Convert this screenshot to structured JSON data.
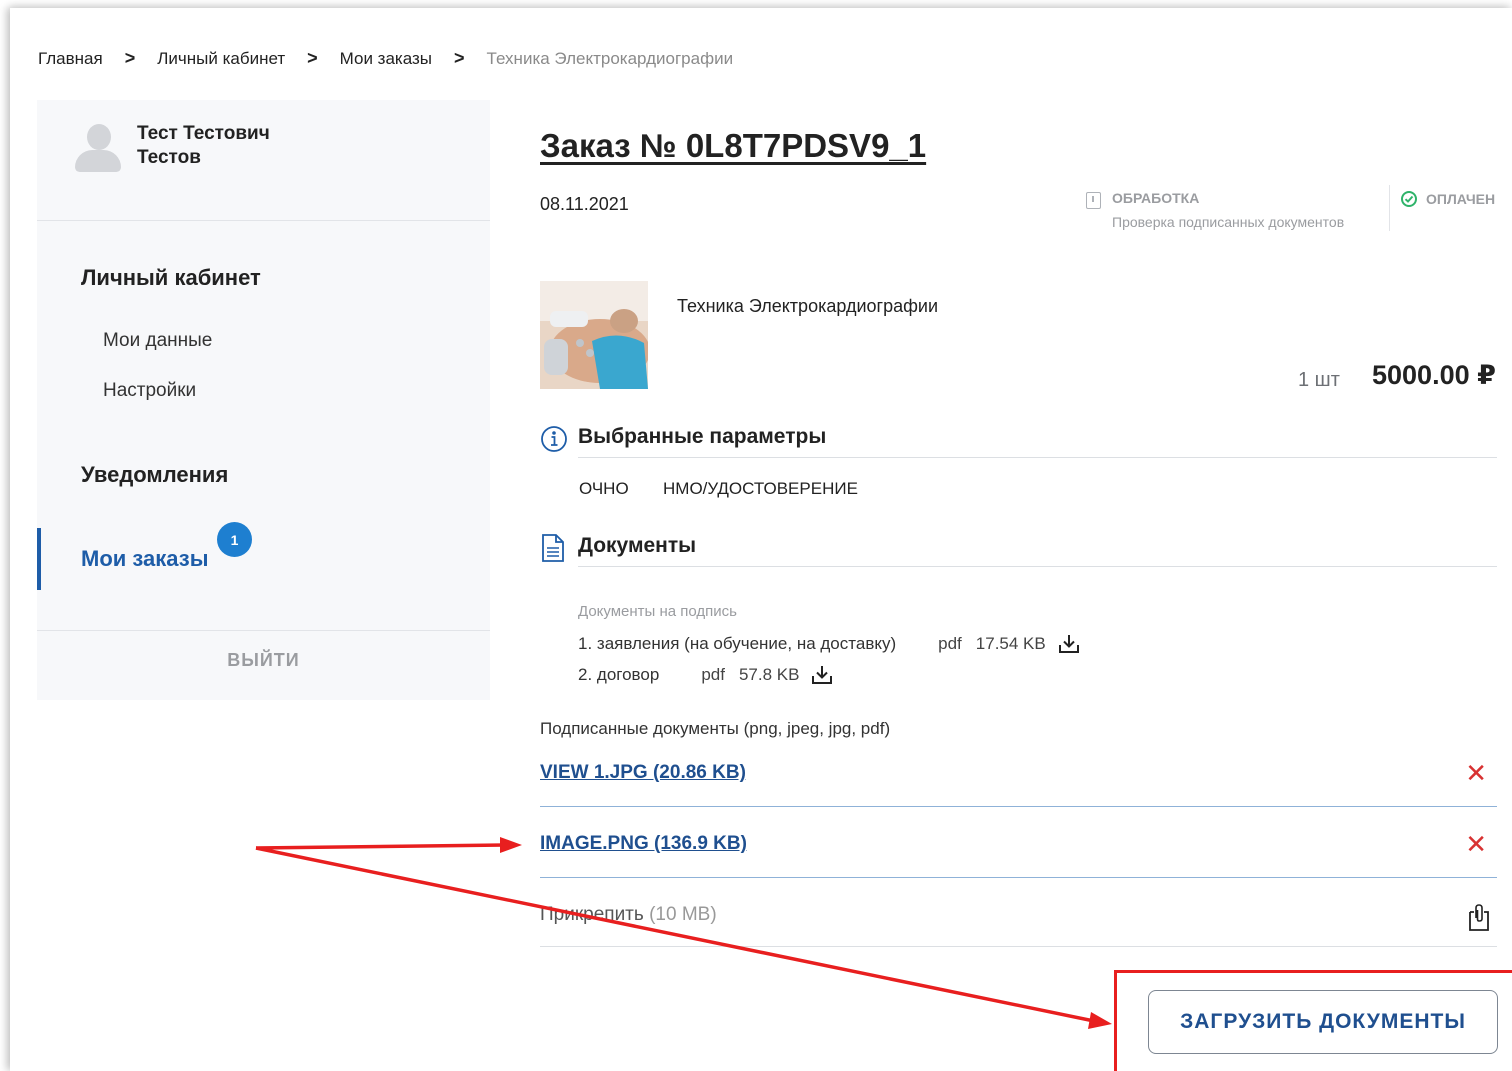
{
  "breadcrumb": {
    "items": [
      "Главная",
      "Личный кабинет",
      "Мои заказы"
    ],
    "current": "Техника Электрокардиографии"
  },
  "sidebar": {
    "user_name_line1": "Тест Тестович",
    "user_name_line2": "Тестов",
    "section_account": "Личный кабинет",
    "item_my_data": "Мои данные",
    "item_settings": "Настройки",
    "section_notifications": "Уведомления",
    "item_my_orders": "Мои заказы",
    "orders_badge": "1",
    "logout": "ВЫЙТИ"
  },
  "order": {
    "title": "Заказ № 0L8T7PDSV9_1",
    "date": "08.11.2021",
    "status_processing": "ОБРАБОТКА",
    "status_processing_sub": "Проверка подписанных документов",
    "status_paid": "ОПЛАЧЕН",
    "product_name": "Техника Электрокардиографии",
    "quantity": "1 шт",
    "price": "5000.00 ₽"
  },
  "params": {
    "heading": "Выбранные параметры",
    "values": [
      "ОЧНО",
      "НМО/УДОСТОВЕРЕНИЕ"
    ]
  },
  "documents": {
    "heading": "Документы",
    "to_sign_label": "Документы на подпись",
    "to_sign": [
      {
        "name": "1. заявления (на обучение, на доставку)",
        "type": "pdf",
        "size": "17.54 KB"
      },
      {
        "name": "2. договор",
        "type": "pdf",
        "size": "57.8 KB"
      }
    ],
    "signed_label": "Подписанные документы (png, jpeg, jpg, pdf)",
    "signed_files": [
      "VIEW 1.JPG (20.86 KB)",
      "IMAGE.PNG (136.9 KB)"
    ],
    "attach_label": "Прикрепить",
    "attach_limit": "(10 MB)",
    "upload_button": "ЗАГРУЗИТЬ ДОКУМЕНТЫ"
  },
  "colors": {
    "accent": "#1e5da8",
    "link": "#1f4f8f",
    "delete": "#d83232",
    "annotation": "#e81f1f",
    "paid_check": "#2fb36a"
  }
}
